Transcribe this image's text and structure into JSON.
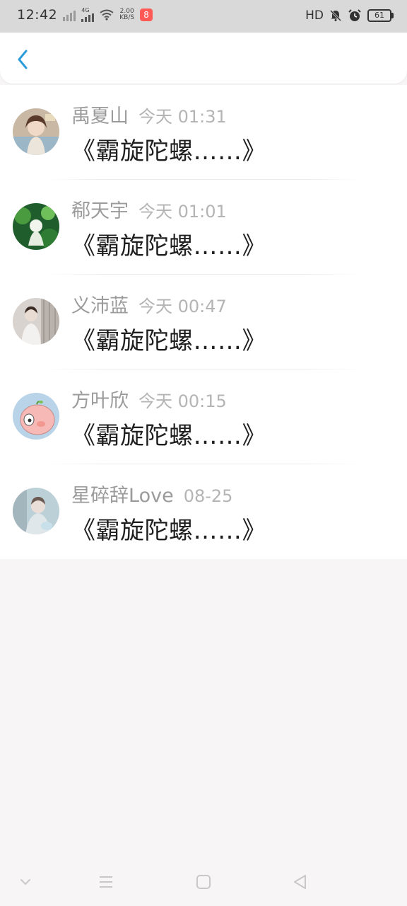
{
  "status_bar": {
    "time": "12:42",
    "network_type": "4G",
    "speed_value": "2.00",
    "speed_unit": "KB/S",
    "hd_label": "HD",
    "battery": "61",
    "notification_app_badge": "8"
  },
  "header": {
    "back_icon": "chevron-left-icon"
  },
  "messages": [
    {
      "name": "禹夏山",
      "time": "今天 01:31",
      "content": "《霸旋陀螺……》"
    },
    {
      "name": "郗天宇",
      "time": "今天 01:01",
      "content": "《霸旋陀螺……》"
    },
    {
      "name": "义沛蓝",
      "time": "今天 00:47",
      "content": "《霸旋陀螺……》"
    },
    {
      "name": "方叶欣",
      "time": "今天 00:15",
      "content": "《霸旋陀螺……》"
    },
    {
      "name": "星碎辞Love",
      "time": "08-25",
      "content": "《霸旋陀螺……》"
    }
  ],
  "colors": {
    "accent": "#2d9cdb",
    "name_text": "#9b9b9b",
    "time_text": "#b4b4b4",
    "content_text": "#1f1f1f",
    "page_bg": "#f7f5f6"
  },
  "navbar": {
    "icons": [
      "chevron-down-icon",
      "menu-icon",
      "home-square-icon",
      "back-triangle-icon"
    ]
  }
}
